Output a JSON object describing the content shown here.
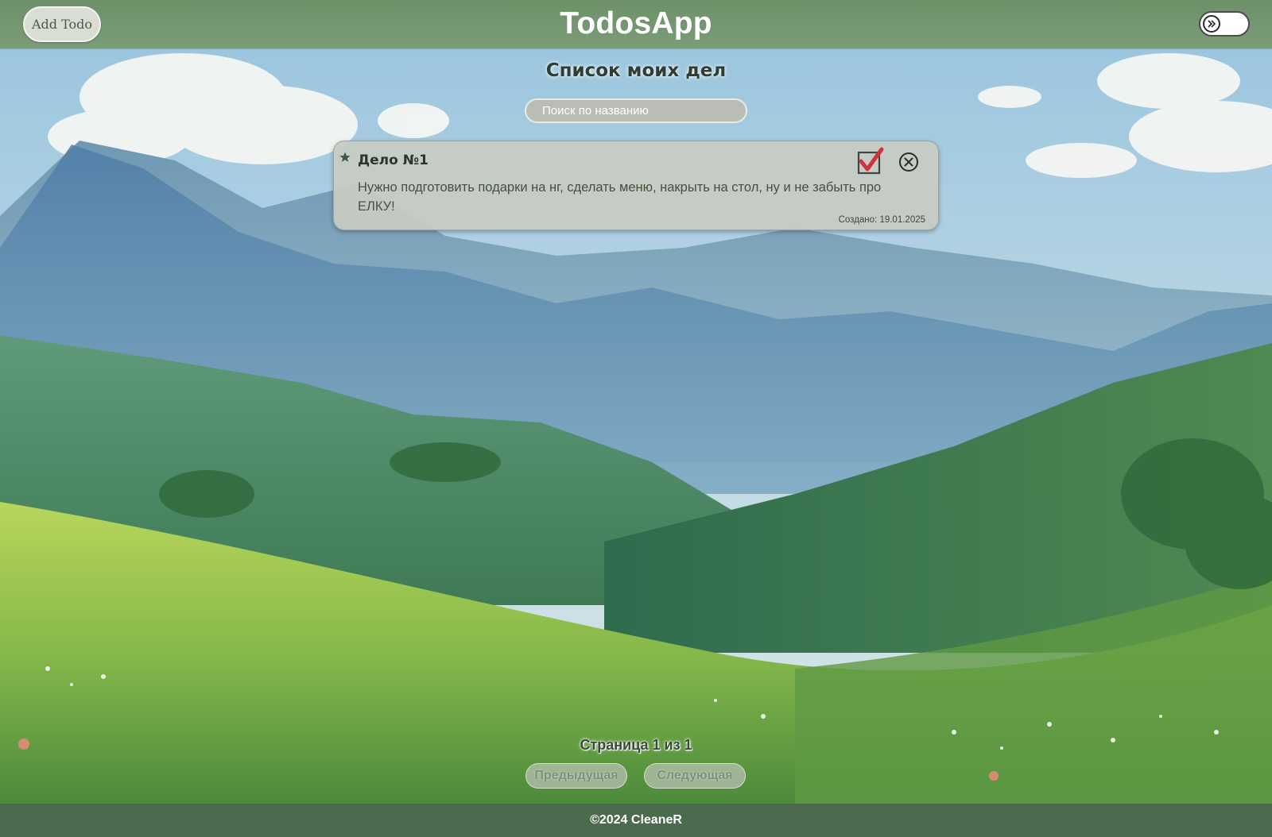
{
  "header": {
    "add_button_label": "Add Todo",
    "app_title": "TodosApp",
    "theme_toggle_icon": "double-chevron-right-icon"
  },
  "main": {
    "title": "Список моих дел",
    "search": {
      "placeholder": "Поиск по названию",
      "value": ""
    },
    "todos": [
      {
        "title": "Дело №1",
        "text": "Нужно подготовить подарки на нг, сделать меню, накрыть на стол, ну и не забыть про ЕЛКУ!",
        "created": "Создано: 19.01.2025",
        "starred": true,
        "completed": true,
        "icons": {
          "star": "star-icon",
          "complete": "checkbox-checked-icon",
          "delete": "close-circle-icon"
        }
      }
    ]
  },
  "pagination": {
    "info": "Страница 1 из 1",
    "prev_label": "Предыдущая",
    "next_label": "Следующая"
  },
  "footer": {
    "text": "©2024 CleaneR"
  },
  "colors": {
    "header_bg": "#7a9c77",
    "footer_bg": "#4c6a4e",
    "card_bg": "#c6cbc3",
    "check_red": "#d0343b"
  }
}
